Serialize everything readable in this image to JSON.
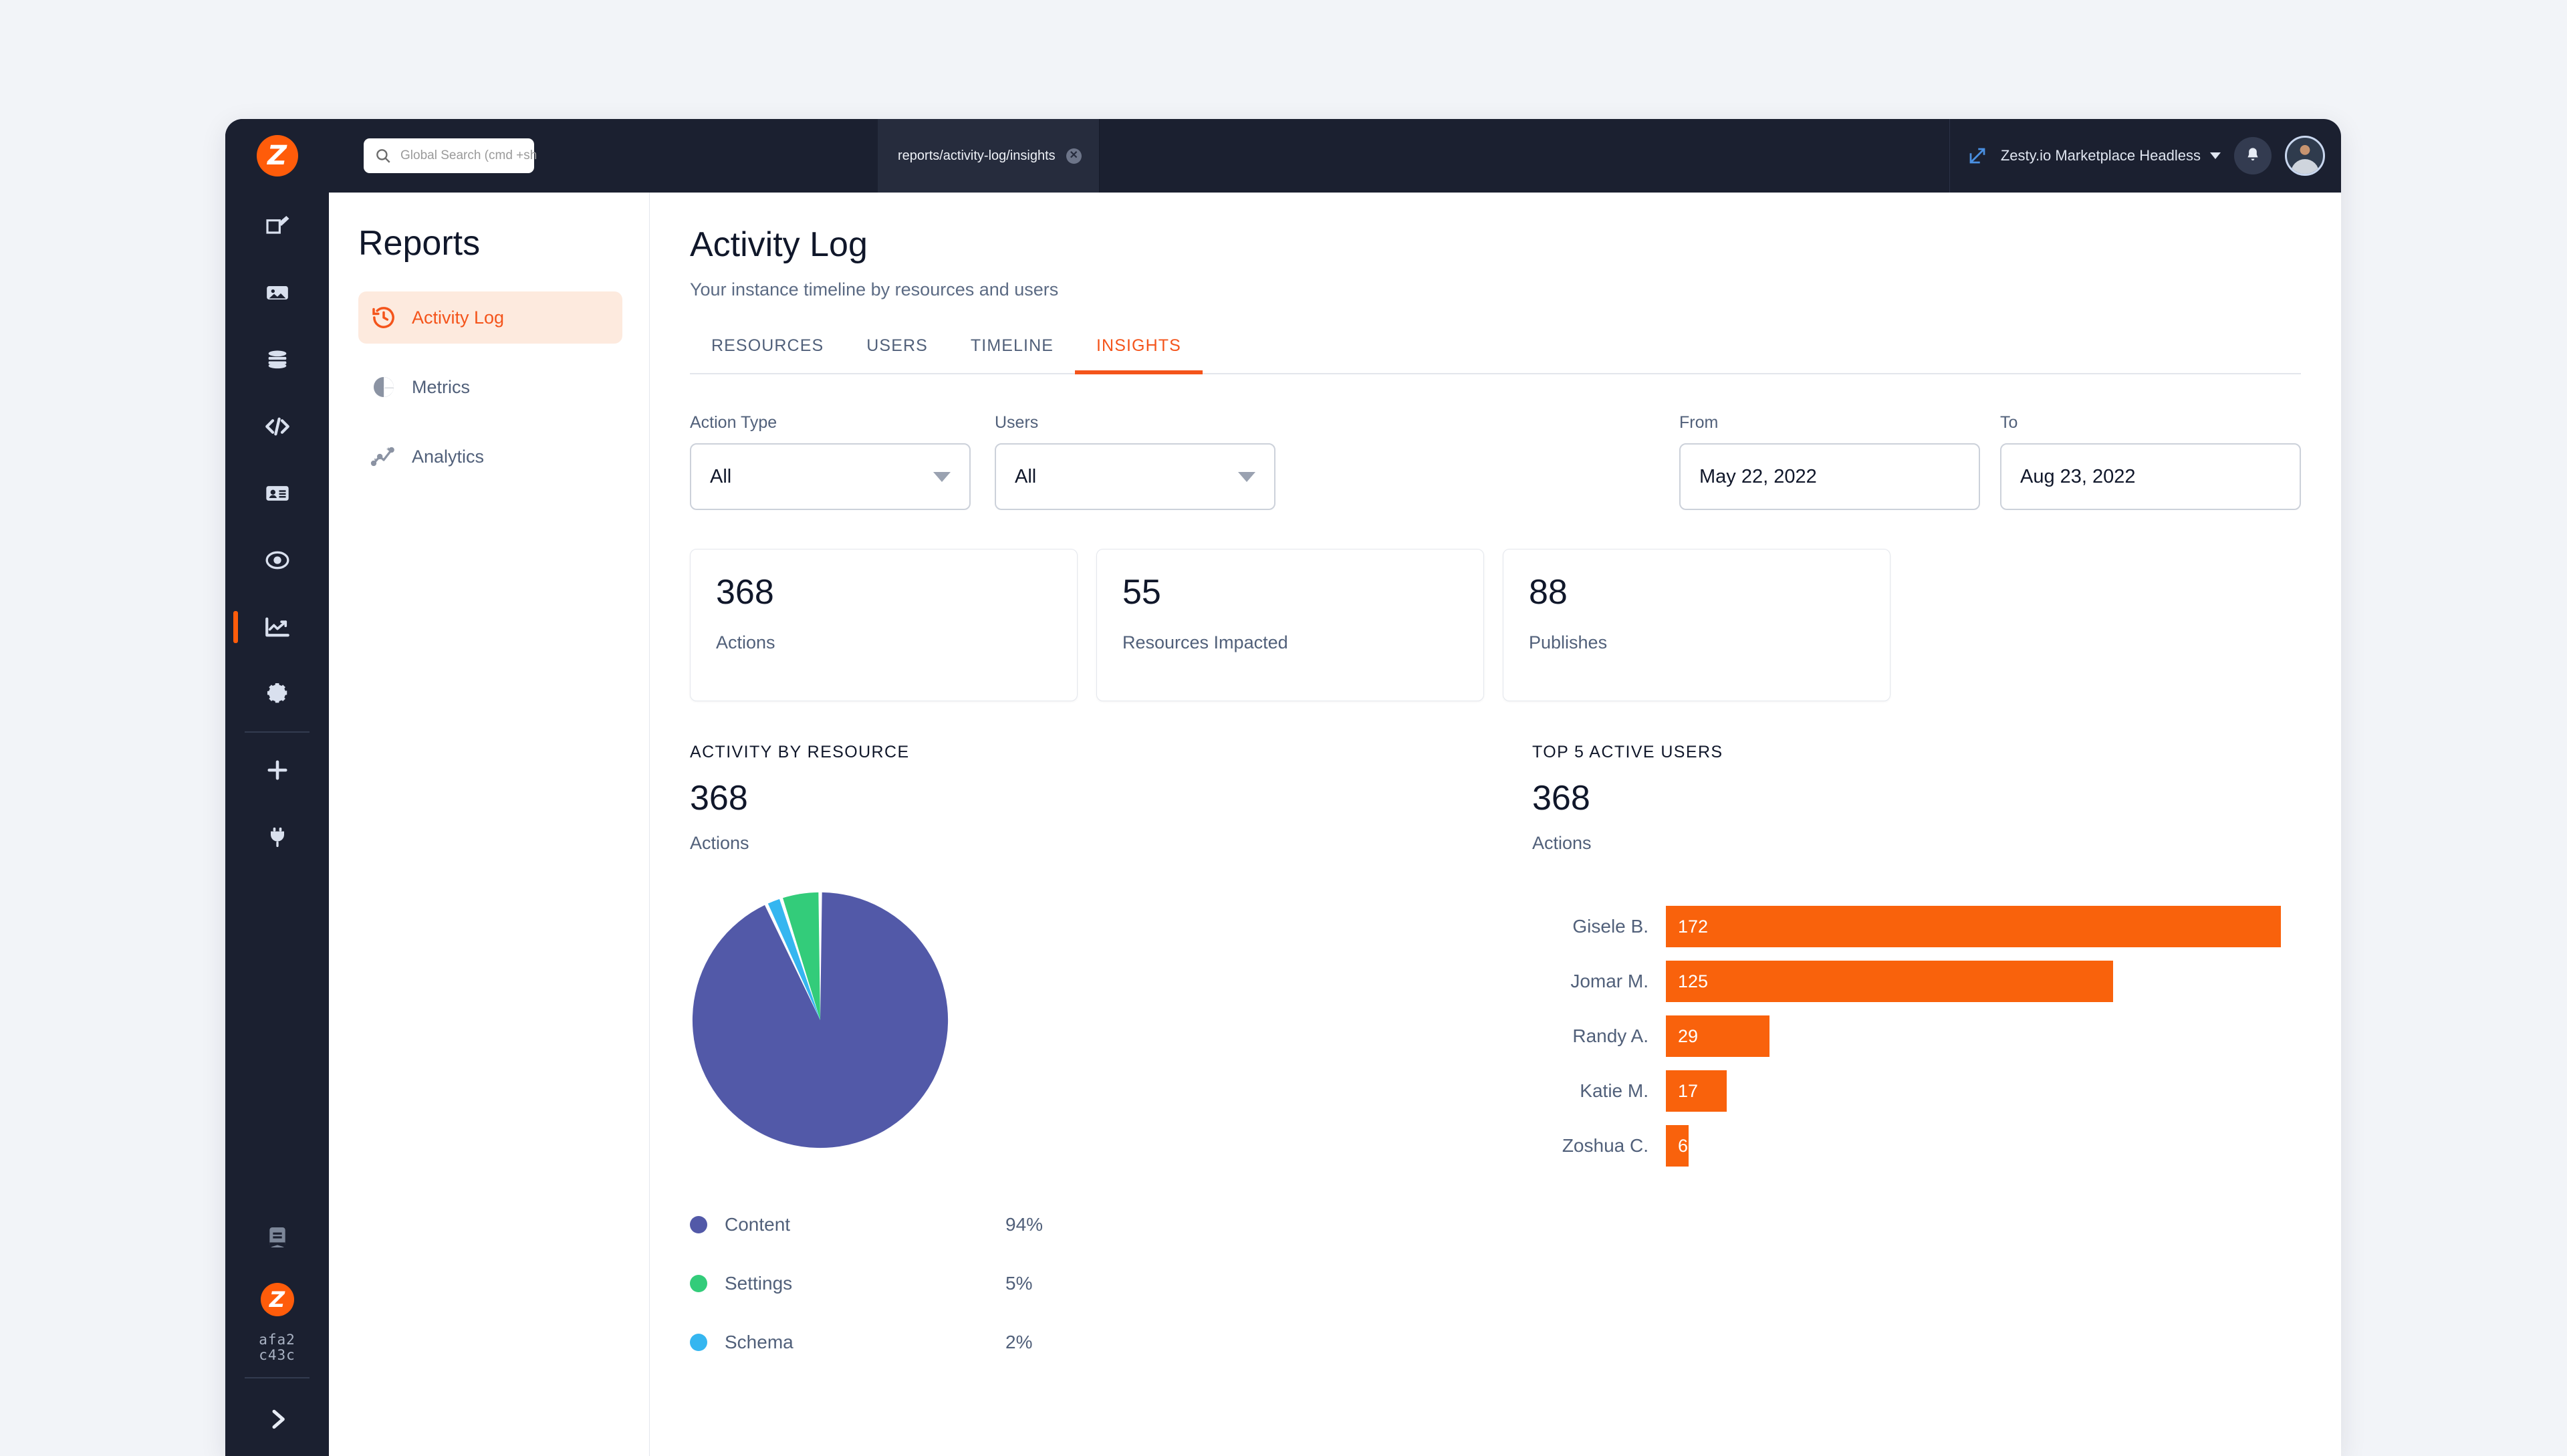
{
  "topbar": {
    "logo_alt": "Zesty logo",
    "search_placeholder": "Global Search (cmd +sh",
    "search_value": "",
    "tab_label": "reports/activity-log/insights",
    "tab_close": "✕",
    "instance_name": "Zesty.io Marketplace Headless"
  },
  "rail": {
    "items": [
      {
        "icon": "edit-pencil-icon",
        "name": "content"
      },
      {
        "icon": "image-icon",
        "name": "media"
      },
      {
        "icon": "database-icon",
        "name": "schema"
      },
      {
        "icon": "code-icon",
        "name": "code"
      },
      {
        "icon": "id-card-icon",
        "name": "leads"
      },
      {
        "icon": "eye-target-icon",
        "name": "seo"
      },
      {
        "icon": "chart-line-icon",
        "name": "reports"
      },
      {
        "icon": "gear-icon",
        "name": "settings"
      },
      {
        "icon": "plus-icon",
        "name": "add"
      },
      {
        "icon": "plug-icon",
        "name": "apps"
      }
    ],
    "book_icon": "book-icon",
    "instance_hash_line1": "afa2",
    "instance_hash_line2": "c43c",
    "expand_icon": "chevron-right-icon"
  },
  "reports_panel": {
    "title": "Reports",
    "items": [
      {
        "label": "Activity Log",
        "icon": "history-clock-icon",
        "active": true
      },
      {
        "label": "Metrics",
        "icon": "pie-chart-icon",
        "active": false
      },
      {
        "label": "Analytics",
        "icon": "sparkle-trend-icon",
        "active": false
      }
    ]
  },
  "page": {
    "title": "Activity Log",
    "subtitle": "Your instance timeline by resources and users",
    "tabs": [
      {
        "label": "RESOURCES",
        "active": false
      },
      {
        "label": "USERS",
        "active": false
      },
      {
        "label": "TIMELINE",
        "active": false
      },
      {
        "label": "INSIGHTS",
        "active": true
      }
    ]
  },
  "filters": {
    "action_type": {
      "label": "Action Type",
      "value": "All"
    },
    "users": {
      "label": "Users",
      "value": "All"
    },
    "from": {
      "label": "From",
      "value": "May 22, 2022"
    },
    "to": {
      "label": "To",
      "value": "Aug 23, 2022"
    }
  },
  "stats": [
    {
      "value": "368",
      "label": "Actions"
    },
    {
      "value": "55",
      "label": "Resources Impacted"
    },
    {
      "value": "88",
      "label": "Publishes"
    }
  ],
  "activity_by_resource": {
    "caption": "ACTIVITY BY RESOURCE",
    "total": "368",
    "total_label": "Actions"
  },
  "top_users": {
    "caption": "TOP 5 ACTIVE USERS",
    "total": "368",
    "total_label": "Actions"
  },
  "colors": {
    "accent_orange": "#f4541b",
    "bar_orange": "#f9620c",
    "pie_content": "#5259a8",
    "pie_settings": "#33cc7a",
    "pie_schema": "#35b6f0",
    "dark_chrome": "#1b2030"
  },
  "chart_data": [
    {
      "type": "pie",
      "title": "ACTIVITY BY RESOURCE",
      "total": 368,
      "total_label": "Actions",
      "labels": [
        "Content",
        "Settings",
        "Schema"
      ],
      "values": [
        94,
        5,
        2
      ],
      "value_display": [
        "94%",
        "5%",
        "2%"
      ],
      "colors": [
        "#5259a8",
        "#33cc7a",
        "#35b6f0"
      ],
      "legend": "bottom-left",
      "grid": false
    },
    {
      "type": "bar",
      "orientation": "horizontal",
      "title": "TOP 5 ACTIVE USERS",
      "total": 368,
      "total_label": "Actions",
      "categories": [
        "Gisele B.",
        "Jomar M.",
        "Randy A.",
        "Katie M.",
        "Zoshua  C."
      ],
      "values": [
        172,
        125,
        29,
        17,
        6
      ],
      "value_labels": [
        "172",
        "125",
        "29",
        "17",
        "6"
      ],
      "color": "#f9620c",
      "xlim": [
        0,
        172
      ],
      "grid": false,
      "legend": "none"
    }
  ]
}
